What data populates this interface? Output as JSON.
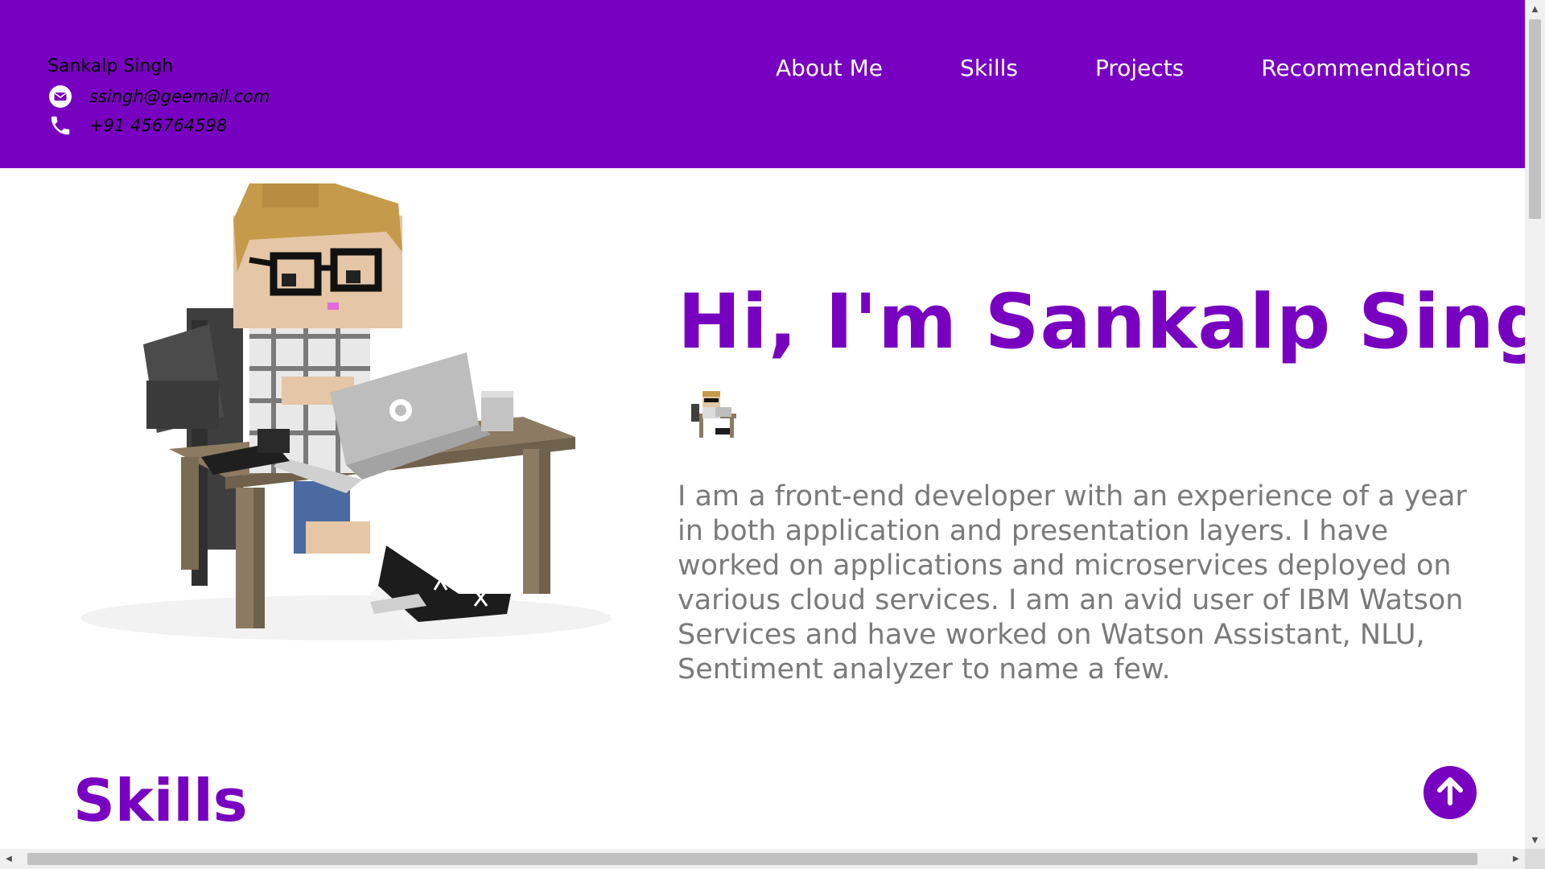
{
  "header": {
    "name": "Sankalp Singh",
    "email": "ssingh@geemail.com",
    "phone": "+91 456764598",
    "icons": {
      "email": "envelope-icon",
      "phone": "phone-icon"
    }
  },
  "nav": {
    "items": [
      {
        "label": "About Me"
      },
      {
        "label": "Skills"
      },
      {
        "label": "Projects"
      },
      {
        "label": "Recommendations"
      }
    ]
  },
  "hero": {
    "title": "Hi, I'm Sankalp Singh!",
    "intro": "I am a front-end developer with an experience of a year in both application and presentation layers. I have worked on applications and microservices deployed on various cloud services. I am an avid user of IBM Watson Services and have worked on Watson Assistant, NLU, Sentiment analyzer to name a few."
  },
  "skills": {
    "title": "Skills"
  },
  "colors": {
    "brand": "#7800c0",
    "nav_text": "#ffffff",
    "body_text": "#7a7a7a"
  }
}
